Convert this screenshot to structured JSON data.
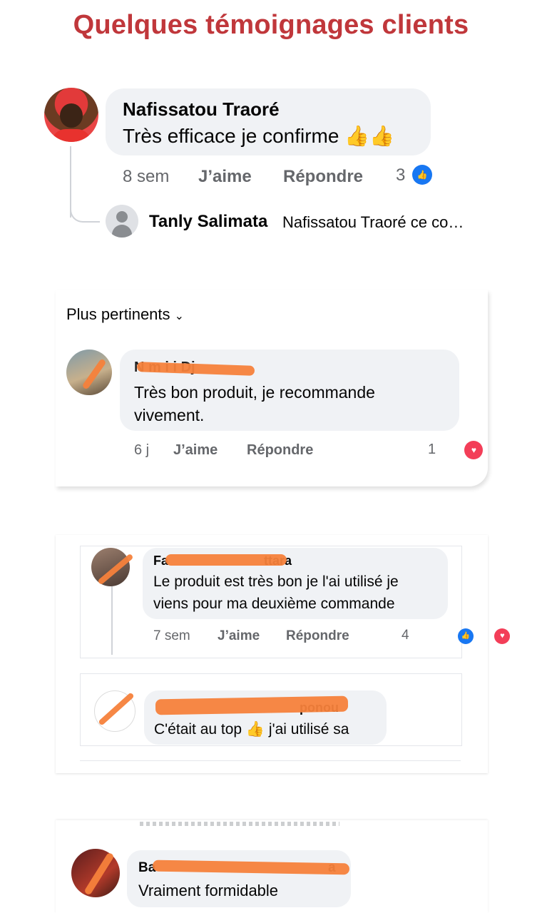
{
  "title": "Quelques témoignages clients",
  "c1": {
    "name": "Nafissatou Traoré",
    "text": "Très efficace je confirme 👍👍",
    "time": "8 sem",
    "like": "J’aime",
    "reply": "Répondre",
    "count": "3",
    "reply_name": "Tanly Salimata",
    "reply_text": "Nafissatou Traoré ce co…"
  },
  "c2": {
    "sort": "Plus pertinents",
    "name": "N m i i  Dj",
    "text1": "Très bon produit, je recommande",
    "text2": "vivement.",
    "time": "6 j",
    "like": "J’aime",
    "reply": "Répondre",
    "count": "1"
  },
  "c3": {
    "name_start": "Fa",
    "name_end": "ttara",
    "text1": "Le produit est très bon je l'ai utilisé je",
    "text2": "viens pour ma deuxième commande",
    "time": "7 sem",
    "like": "J’aime",
    "reply": "Répondre",
    "count": "4"
  },
  "c4": {
    "name_end": "ponou",
    "text": "C'était au top 👍 j'ai utilisé sa"
  },
  "c5": {
    "name_start": "Ba",
    "name_end": "a",
    "text": "Vraiment formidable"
  },
  "colors": {
    "title": "#c0373b",
    "like": "#1877f2",
    "love": "#f33e58",
    "scribble": "#f5813b"
  },
  "icons": [
    "thumbs-up-icon",
    "heart-icon",
    "chevron-down-icon",
    "default-avatar-icon"
  ]
}
